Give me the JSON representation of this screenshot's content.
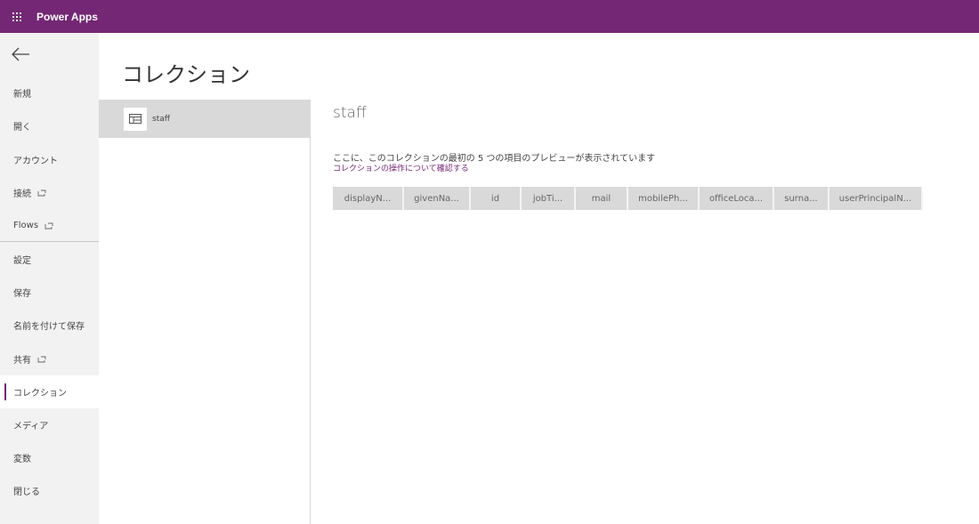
{
  "app": {
    "title": "Power Apps"
  },
  "sidebar": {
    "items": [
      {
        "label": "新規",
        "external": false
      },
      {
        "label": "開く",
        "external": false
      },
      {
        "label": "アカウント",
        "external": false
      },
      {
        "label": "接続",
        "external": true
      },
      {
        "label": "Flows",
        "external": true
      },
      {
        "label": "設定",
        "external": false
      },
      {
        "label": "保存",
        "external": false
      },
      {
        "label": "名前を付けて保存",
        "external": false
      },
      {
        "label": "共有",
        "external": true
      },
      {
        "label": "コレクション",
        "external": false,
        "active": true
      },
      {
        "label": "メディア",
        "external": false
      },
      {
        "label": "変数",
        "external": false
      },
      {
        "label": "閉じる",
        "external": false
      }
    ]
  },
  "page": {
    "title": "コレクション"
  },
  "collections": [
    {
      "name": "staff"
    }
  ],
  "detail": {
    "name": "staff",
    "description": "ここに、このコレクションの最初の 5 つの項目のプレビューが表示されています",
    "link": "コレクションの操作について確認する",
    "columns": [
      "displayN...",
      "givenNa...",
      "id",
      "jobTi...",
      "mail",
      "mobilePh...",
      "officeLoca...",
      "surna...",
      "userPrincipalN..."
    ]
  },
  "colors": {
    "brand": "#742774",
    "sidebar_bg": "#f2f2f2",
    "selected_bg": "#d9d9d9"
  }
}
